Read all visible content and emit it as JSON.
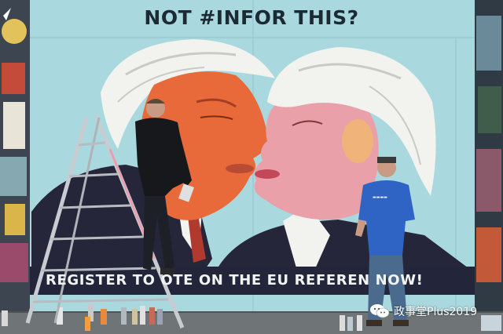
{
  "mural": {
    "headline": "NOT #INFOR THIS?",
    "slogan": "REGISTER TO  OTE ON THE EU REFEREN    NOW!"
  },
  "watermark": {
    "text": "政事堂Plus2019",
    "icon": "wechat-icon"
  },
  "colors": {
    "wall_blue": "#a9d9df",
    "suit_navy": "#25263a",
    "skin_orange": "#e86a3a",
    "hair_white": "#f2f2ef",
    "worker_shirt_blue": "#2f63c4",
    "ground": "#6f7477"
  }
}
